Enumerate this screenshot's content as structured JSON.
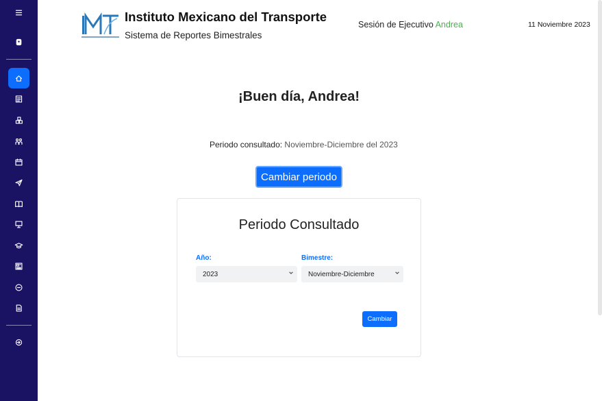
{
  "header": {
    "institute": "Instituto Mexicano del Transporte",
    "system": "Sistema de Reportes Bimestrales",
    "session_prefix": "Sesión de Ejecutivo",
    "session_user": "Andrea",
    "date": "11 Noviembre 2023"
  },
  "main": {
    "greeting": "¡Buen día, Andrea!",
    "period_label": "Periodo consultado:",
    "period_value": "Noviembre-Diciembre del 2023",
    "change_period_button": "Cambiar periodo"
  },
  "card": {
    "title": "Periodo Consultado",
    "year_label": "Año:",
    "year_value": "2023",
    "bimester_label": "Bimestre:",
    "bimester_value": "Noviembre-Diciembre",
    "submit_button": "Cambiar"
  },
  "sidebar": {
    "items": [
      {
        "icon": "menu-icon"
      },
      {
        "icon": "badge-icon"
      },
      {
        "icon": "home-icon",
        "active": true
      },
      {
        "icon": "reports-icon"
      },
      {
        "icon": "boxes-icon"
      },
      {
        "icon": "people-icon"
      },
      {
        "icon": "calendar-icon"
      },
      {
        "icon": "send-icon"
      },
      {
        "icon": "book-icon"
      },
      {
        "icon": "presentation-icon"
      },
      {
        "icon": "graduation-icon"
      },
      {
        "icon": "newspaper-icon"
      },
      {
        "icon": "minus-circle-icon"
      },
      {
        "icon": "document-icon"
      },
      {
        "icon": "logout-icon"
      }
    ]
  },
  "colors": {
    "sidebar_bg": "#1a1363",
    "accent": "#0d6efd",
    "session_user": "#4caf50"
  }
}
